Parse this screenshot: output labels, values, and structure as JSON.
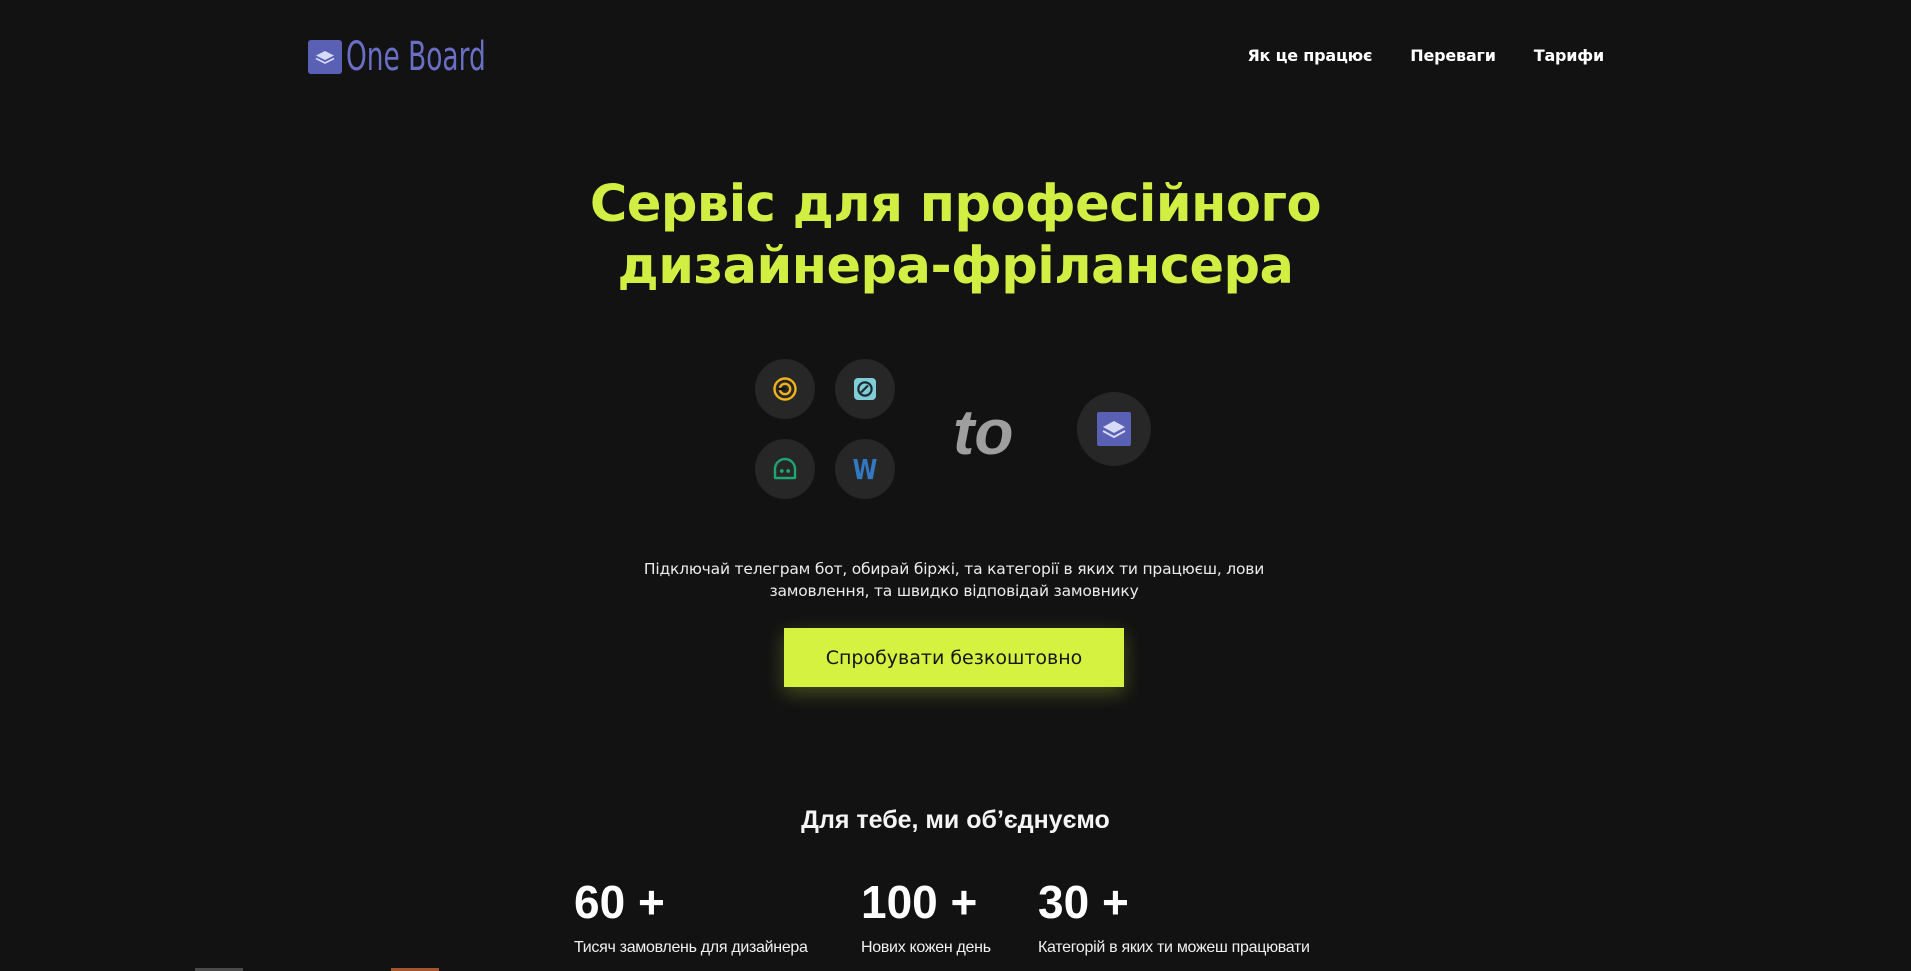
{
  "header": {
    "logo_text": "One Board",
    "nav": [
      {
        "label": "Як це працює"
      },
      {
        "label": "Переваги"
      },
      {
        "label": "Тарифи"
      }
    ]
  },
  "hero": {
    "title_line1": "Сервіс для професійного",
    "title_line2": "дизайнера-фрілансера",
    "connector_text": "to",
    "source_icons": [
      "freelancehunt-icon",
      "kabanchik-icon",
      "freelance-ua-icon",
      "weblancer-icon"
    ],
    "target_icon": "oneboard-logo-icon",
    "description": "Підключай телеграм бот, обирай біржі, та категорії в яких ти працюєш, лови замовлення, та швидко відповідай замовнику",
    "cta_label": "Спробувати безкоштовно"
  },
  "stats": {
    "title": "Для тебе, ми об’єднуємо",
    "items": [
      {
        "number": "60 +",
        "label": "Тисяч замовлень для дизайнера"
      },
      {
        "number": "100 +",
        "label": "Нових кожен день"
      },
      {
        "number": "30 +",
        "label": "Категорій в яких ти можеш працювати"
      }
    ]
  },
  "colors": {
    "background": "#121212",
    "accent": "#d1ef43",
    "brand": "#5a60b4",
    "icon_circle": "#272727"
  }
}
